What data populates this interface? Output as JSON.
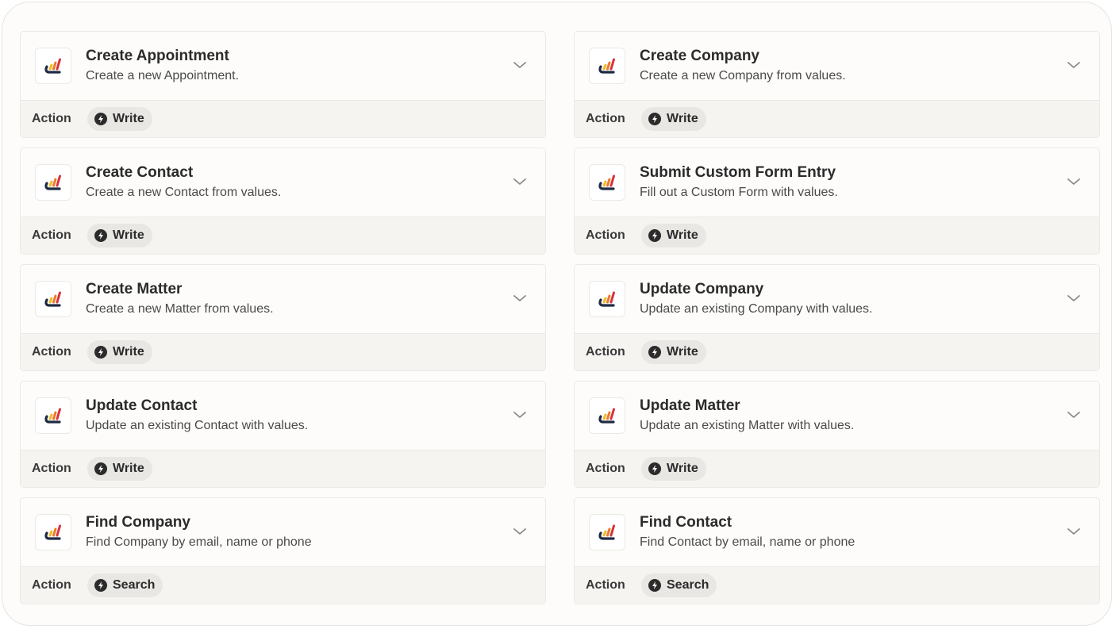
{
  "cards": [
    {
      "title": "Create Appointment",
      "description": "Create a new Appointment.",
      "type_label": "Action",
      "badge": "Write",
      "badge_icon": "bolt-icon"
    },
    {
      "title": "Create Company",
      "description": "Create a new Company from values.",
      "type_label": "Action",
      "badge": "Write",
      "badge_icon": "bolt-icon"
    },
    {
      "title": "Create Contact",
      "description": "Create a new Contact from values.",
      "type_label": "Action",
      "badge": "Write",
      "badge_icon": "bolt-icon"
    },
    {
      "title": "Submit Custom Form Entry",
      "description": "Fill out a Custom Form with values.",
      "type_label": "Action",
      "badge": "Write",
      "badge_icon": "bolt-icon"
    },
    {
      "title": "Create Matter",
      "description": "Create a new Matter from values.",
      "type_label": "Action",
      "badge": "Write",
      "badge_icon": "bolt-icon"
    },
    {
      "title": "Update Company",
      "description": "Update an existing Company with values.",
      "type_label": "Action",
      "badge": "Write",
      "badge_icon": "bolt-icon"
    },
    {
      "title": "Update Contact",
      "description": "Update an existing Contact with values.",
      "type_label": "Action",
      "badge": "Write",
      "badge_icon": "bolt-icon"
    },
    {
      "title": "Update Matter",
      "description": "Update an existing Matter with values.",
      "type_label": "Action",
      "badge": "Write",
      "badge_icon": "bolt-icon"
    },
    {
      "title": "Find Company",
      "description": "Find Company by email, name or phone",
      "type_label": "Action",
      "badge": "Search",
      "badge_icon": "bolt-icon"
    },
    {
      "title": "Find Contact",
      "description": "Find Contact by email, name or phone",
      "type_label": "Action",
      "badge": "Search",
      "badge_icon": "bolt-icon"
    }
  ],
  "colors": {
    "logo_navy": "#1f2a44",
    "logo_yellow": "#f2b824",
    "logo_orange": "#ec7a2a",
    "logo_red": "#d8323c"
  }
}
